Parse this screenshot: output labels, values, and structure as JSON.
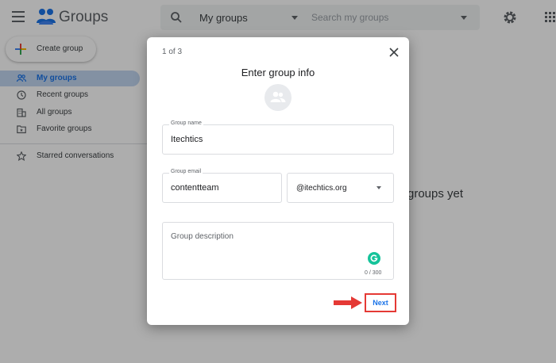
{
  "header": {
    "app_title": "Groups",
    "scope_label": "My groups",
    "search_placeholder": "Search my groups"
  },
  "sidebar": {
    "create_label": "Create group",
    "items": [
      {
        "label": "My groups",
        "icon": "people-icon",
        "active": true
      },
      {
        "label": "Recent groups",
        "icon": "clock-icon",
        "active": false
      },
      {
        "label": "All groups",
        "icon": "building-icon",
        "active": false
      },
      {
        "label": "Favorite groups",
        "icon": "folder-star-icon",
        "active": false
      },
      {
        "label": "Starred conversations",
        "icon": "star-icon",
        "active": false
      }
    ]
  },
  "main": {
    "empty_text": "groups yet"
  },
  "dialog": {
    "step": "1 of 3",
    "title": "Enter group info",
    "group_name_label": "Group name",
    "group_name_value": "Itechtics",
    "group_email_label": "Group email",
    "group_email_value": "contentteam",
    "domain_value": "@itechtics.org",
    "description_placeholder": "Group description",
    "description_counter": "0 / 300",
    "next_label": "Next"
  },
  "colors": {
    "accent": "#1a73e8",
    "active_nav_bg": "#c2d6f1",
    "highlight_red": "#e53935",
    "grammarly": "#15c39a"
  }
}
